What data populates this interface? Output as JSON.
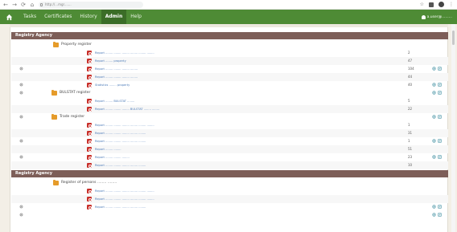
{
  "browser": {
    "back": "←",
    "forward": "→",
    "reload": "⟳",
    "home": "⌂",
    "url": "http://...mgr.......",
    "star": "☆",
    "menu": "⋮"
  },
  "nav": {
    "items": [
      {
        "label": "Tasks"
      },
      {
        "label": "Certificates"
      },
      {
        "label": "History"
      },
      {
        "label": "Admin",
        "active": true
      },
      {
        "label": "Help"
      }
    ],
    "user": "a.user@........."
  },
  "sections": [
    {
      "title": "Registry Agency",
      "groups": [
        {
          "title": "Property register",
          "rows": [
            {
              "label": "Report ........ ........ ........ ........ ........ ........",
              "count": "2"
            },
            {
              "label": "Report ........ property",
              "count": "47"
            },
            {
              "label": "Report ........ ........ ........ ........",
              "count": "104"
            },
            {
              "label": "Report ........ ........ ........ ........",
              "count": "44"
            },
            {
              "label": "Statistics ........ property",
              "count": "40"
            }
          ]
        },
        {
          "title": "BULSTAT register",
          "rows": [
            {
              "label": "Report ........ BULSTAT ........",
              "count": "5"
            },
            {
              "label": "Report ........ ........ ........ BULSTAT ........ ........",
              "count": "22"
            }
          ]
        },
        {
          "title": "Trade register",
          "rows": [
            {
              "label": "Report ........ ........ ........ ........ ........ ........",
              "count": "1"
            },
            {
              "label": "Report ........ ........ ........ ........ ........",
              "count": "31"
            },
            {
              "label": "Report ........ ........ ........ ........ ........",
              "count": "1"
            },
            {
              "label": "Report ........ ........",
              "count": "51"
            },
            {
              "label": "Report ........ ........ ........",
              "count": "23"
            },
            {
              "label": "Report ........ ........ ........ ........ ........",
              "count": "10"
            }
          ]
        }
      ]
    },
    {
      "title": "Registry Agency",
      "groups": [
        {
          "title": "Register of persons ........ ........",
          "rows": [
            {
              "label": "Report ........ ........ ........ ........ ........ ........",
              "count": ""
            },
            {
              "label": "Report ........ ........ ........ ........ ........ ........",
              "count": ""
            },
            {
              "label": "Report ........ ........ ........ ........ ........",
              "count": ""
            }
          ]
        }
      ]
    }
  ],
  "colors": {
    "nav_green": "#4e8b35",
    "section_bar": "#7d5e58",
    "link_blue": "#4b7ab8",
    "report_icon_red": "#c8302b",
    "folder_orange": "#e59b2a"
  },
  "icons": {
    "row_left": "settings-icon",
    "row_report": "search-report-icon",
    "row_actions": [
      "view-icon",
      "edit-icon"
    ],
    "group": "folder-icon"
  }
}
